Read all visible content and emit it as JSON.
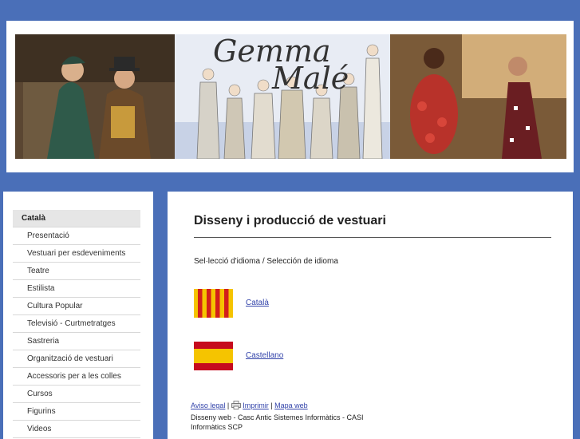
{
  "header": {
    "logo_line1": "Gemma",
    "logo_line2": "Malé"
  },
  "sidebar": {
    "items": [
      {
        "label": "Català",
        "active": true
      },
      {
        "label": "Presentació"
      },
      {
        "label": "Vestuari per esdeveniments"
      },
      {
        "label": "Teatre"
      },
      {
        "label": "Estilista"
      },
      {
        "label": "Cultura Popular"
      },
      {
        "label": "Televisió - Curtmetratges"
      },
      {
        "label": "Sastreria"
      },
      {
        "label": "Organització de vestuari"
      },
      {
        "label": "Accessoris per a les colles"
      },
      {
        "label": "Cursos"
      },
      {
        "label": "Figurins"
      },
      {
        "label": "Videos"
      }
    ]
  },
  "main": {
    "title": "Disseny i producció de vestuari",
    "lang_note": "Sel·lecció d'idioma / Selección de idioma",
    "languages": [
      {
        "label": "Català",
        "flag": "catalan-flag-icon"
      },
      {
        "label": "Castellano",
        "flag": "spanish-flag-icon"
      }
    ]
  },
  "footer": {
    "legal": "Aviso legal",
    "sep1": "|",
    "print": "Imprimir",
    "sep2": "|",
    "sitemap": "Mapa web",
    "credit": "Disseny web - Casc Antic Sistemes Informàtics - CASI Informàtics SCP"
  },
  "colors": {
    "page_bg": "#4a6fb8",
    "link": "#3344aa",
    "active_menu_bg": "#e6e6e6"
  }
}
